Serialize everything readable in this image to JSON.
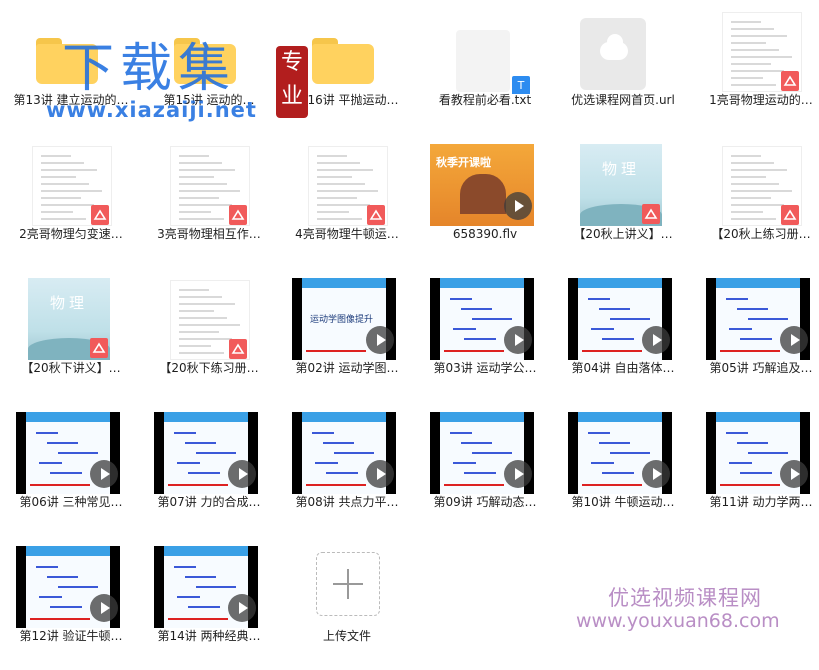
{
  "files": [
    {
      "name": "第13讲 建立运动的…",
      "kind": "folder"
    },
    {
      "name": "第15讲 运动的…",
      "kind": "folder"
    },
    {
      "name": "第16讲 平抛运动…",
      "kind": "folder"
    },
    {
      "name": "看教程前必看.txt",
      "kind": "txt"
    },
    {
      "name": "优选课程网首页.url",
      "kind": "url"
    },
    {
      "name": "1亮哥物理运动的…",
      "kind": "pdf"
    },
    {
      "name": "2亮哥物理匀变速…",
      "kind": "pdf"
    },
    {
      "name": "3亮哥物理相互作…",
      "kind": "pdf"
    },
    {
      "name": "4亮哥物理牛顿运…",
      "kind": "pdf"
    },
    {
      "name": "658390.flv",
      "kind": "flv",
      "thumb_text": "秋季开课啦"
    },
    {
      "name": "【20秋上讲义】…",
      "kind": "cover",
      "cover_text": "物理"
    },
    {
      "name": "【20秋上练习册…",
      "kind": "pdf"
    },
    {
      "name": "【20秋下讲义】…",
      "kind": "cover",
      "cover_text": "物理"
    },
    {
      "name": "【20秋下练习册…",
      "kind": "pdf"
    },
    {
      "name": "第02讲 运动学图…",
      "kind": "video",
      "thumb_text": "运动学图像提升"
    },
    {
      "name": "第03讲 运动学公…",
      "kind": "video"
    },
    {
      "name": "第04讲 自由落体…",
      "kind": "video"
    },
    {
      "name": "第05讲 巧解追及…",
      "kind": "video"
    },
    {
      "name": "第06讲 三种常见…",
      "kind": "video"
    },
    {
      "name": "第07讲 力的合成…",
      "kind": "video"
    },
    {
      "name": "第08讲 共点力平…",
      "kind": "video"
    },
    {
      "name": "第09讲 巧解动态…",
      "kind": "video"
    },
    {
      "name": "第10讲 牛顿运动…",
      "kind": "video"
    },
    {
      "name": "第11讲 动力学两…",
      "kind": "video"
    },
    {
      "name": "第12讲 验证牛顿…",
      "kind": "video"
    },
    {
      "name": "第14讲 两种经典…",
      "kind": "video"
    },
    {
      "name": "上传文件",
      "kind": "upload"
    }
  ],
  "watermark": {
    "top_text": "下载集",
    "seal_text": "专业",
    "top_url": "www.xiazaiji.net",
    "br_text": "优选视频课程网",
    "br_url": "www.youxuan68.com"
  },
  "colors": {
    "folder": "#ffd25f",
    "pdf_badge": "#f15a5a",
    "txt_badge": "#2d8cf0",
    "watermark_blue": "#1f6fe0",
    "watermark_purple": "#b98ec5"
  },
  "icons": {
    "folder": "folder-icon",
    "pdf": "pdf-icon",
    "txt": "txt-file-icon",
    "url": "cloud-link-icon",
    "video": "play-icon",
    "upload": "plus-icon"
  }
}
